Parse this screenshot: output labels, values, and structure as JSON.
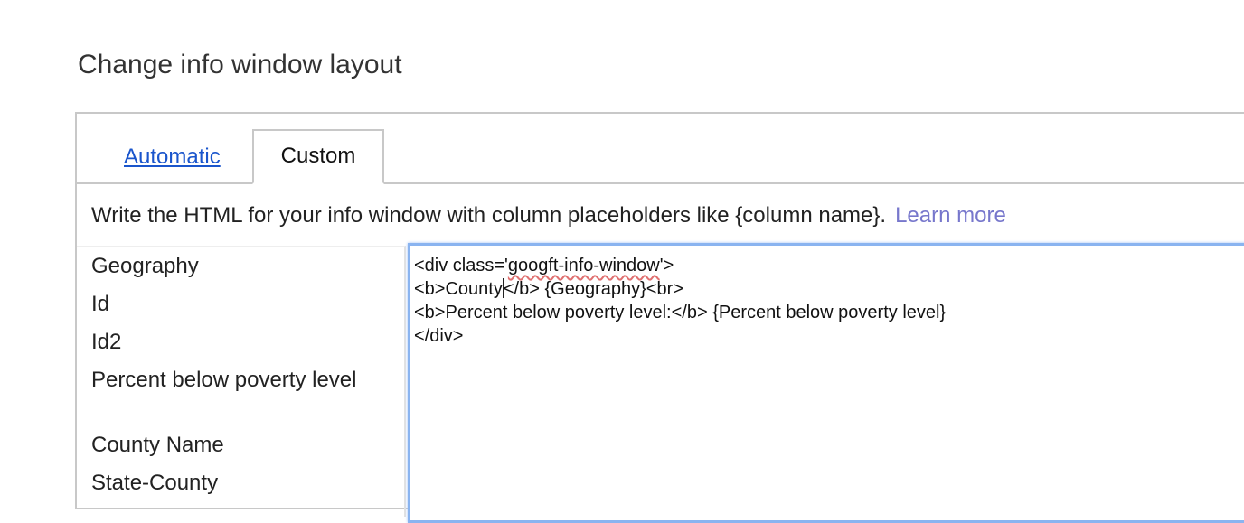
{
  "dialog": {
    "title": "Change info window layout"
  },
  "tabs": {
    "automatic": "Automatic",
    "custom": "Custom",
    "active": "Custom"
  },
  "instructions": {
    "text": "Write the HTML for your info window with column placeholders like {column name}.",
    "learn_more": "Learn more"
  },
  "columns": [
    "Geography",
    "Id",
    "Id2",
    "Percent below poverty level",
    "County Name",
    "State-County"
  ],
  "editor": {
    "line1_prefix": "<div class='",
    "line1_misspelled": "googft-info-window",
    "line1_suffix": "'>",
    "line2_before_caret": "<b>County",
    "line2_after_caret": "</b> {Geography}<br>",
    "line3": "<b>Percent below poverty level:</b> {Percent below poverty level}",
    "line4": "</div>"
  },
  "colors": {
    "link": "#1a55cc",
    "learn_more": "#7777cc",
    "editor_focus_border": "#8ab4f0",
    "spellcheck_underline": "#e07070"
  }
}
